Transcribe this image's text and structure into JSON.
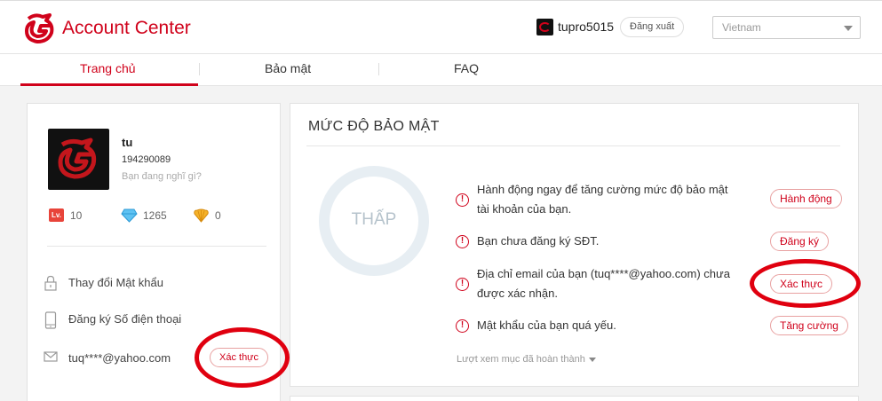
{
  "header": {
    "brand": "Account Center",
    "username": "tupro5015",
    "logout_label": "Đăng xuất",
    "region": "Vietnam",
    "accent_color": "#d0021b"
  },
  "tabs": [
    {
      "label": "Trang chủ",
      "active": true
    },
    {
      "label": "Bảo mật",
      "active": false
    },
    {
      "label": "FAQ",
      "active": false
    }
  ],
  "profile": {
    "name": "tu",
    "uid": "194290089",
    "status_placeholder": "Bạn đang nghĩ gì?",
    "level": "10",
    "level_badge": "Lv.",
    "diamonds": "1265",
    "shells": "0"
  },
  "sidebar_menu": [
    {
      "label": "Thay đổi Mật khẩu",
      "icon": "lock-icon"
    },
    {
      "label": "Đăng ký Số điện thoại",
      "icon": "phone-icon"
    },
    {
      "label": "tuq****@yahoo.com",
      "icon": "mail-icon",
      "action": "Xác thực"
    }
  ],
  "security": {
    "title": "MỨC ĐỘ BẢO MẬT",
    "level": "THẤP",
    "items": [
      {
        "text_line1": "Hành động ngay để tăng cường mức độ bảo mật",
        "text_line2": "tài khoản của bạn.",
        "action": "Hành động"
      },
      {
        "text_line1": "Bạn chưa đăng ký SĐT.",
        "text_line2": "",
        "action": "Đăng ký"
      },
      {
        "text_line1": "Địa chỉ email của bạn (tuq****@yahoo.com) chưa",
        "text_line2": "được xác nhận.",
        "action": "Xác thực"
      },
      {
        "text_line1": "Mật khẩu của bạn quá yếu.",
        "text_line2": "",
        "action": "Tăng cường"
      }
    ],
    "more_label": "Lượt xem mục đã hoàn thành"
  }
}
